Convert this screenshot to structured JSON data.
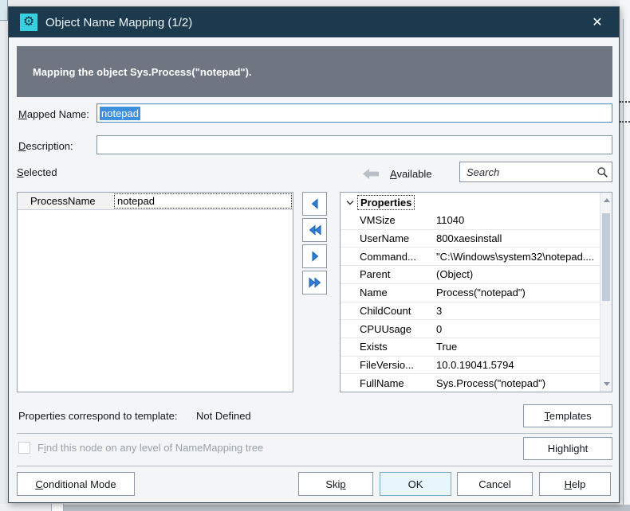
{
  "window": {
    "title": "Object Name Mapping (1/2)",
    "icons": {
      "app_glyph": "⚙",
      "close_glyph": "✕"
    }
  },
  "banner": {
    "text": "Mapping the object Sys.Process(\"notepad\")."
  },
  "fields": {
    "mapped_name": {
      "pre": "",
      "key": "M",
      "post": "apped Name:",
      "value": "notepad"
    },
    "description": {
      "pre": "",
      "key": "D",
      "post": "escription:",
      "value": ""
    }
  },
  "selected": {
    "label": {
      "pre": "",
      "key": "S",
      "post": "elected"
    },
    "rows": [
      {
        "name": "ProcessName",
        "value": "notepad"
      }
    ]
  },
  "available": {
    "label": {
      "pre": "",
      "key": "A",
      "post": "vailable"
    },
    "search_placeholder": "Search",
    "group_header": "Properties",
    "rows": [
      {
        "name": "VMSize",
        "value": "11040"
      },
      {
        "name": "UserName",
        "value": "800xaesinstall"
      },
      {
        "name": "Command...",
        "value": "\"C:\\Windows\\system32\\notepad...."
      },
      {
        "name": "Parent",
        "value": "(Object)"
      },
      {
        "name": "Name",
        "value": "Process(\"notepad\")"
      },
      {
        "name": "ChildCount",
        "value": "3"
      },
      {
        "name": "CPUUsage",
        "value": "0"
      },
      {
        "name": "Exists",
        "value": "True"
      },
      {
        "name": "FileVersio...",
        "value": "10.0.19041.5794"
      },
      {
        "name": "FullName",
        "value": "Sys.Process(\"notepad\")"
      }
    ]
  },
  "footer": {
    "template_label": "Properties correspond to template:",
    "template_value": "Not Defined",
    "templates_btn": {
      "pre": "",
      "key": "T",
      "post": "emplates"
    },
    "find_node_label": {
      "pre": "F",
      "key": "i",
      "post": "nd this node on any level of NameMapping tree"
    },
    "highlight_btn": {
      "pre": "Hi",
      "key": "g",
      "post": "hlight"
    },
    "conditional_btn": {
      "pre": "",
      "key": "C",
      "post": "onditional Mode"
    },
    "skip_btn": {
      "pre": "Ski",
      "key": "p",
      "post": ""
    },
    "ok_btn": "OK",
    "cancel_btn": "Cancel",
    "help_btn": {
      "pre": "",
      "key": "H",
      "post": "elp"
    }
  },
  "colors": {
    "titlebar": "#1c3a4e",
    "icon_cyan": "#38cfe1",
    "banner_gray": "#6f7681",
    "selection_blue": "#3d8fe0",
    "arrow_blue": "#2f7fd8",
    "ok_fill": "#e9f5fc"
  }
}
